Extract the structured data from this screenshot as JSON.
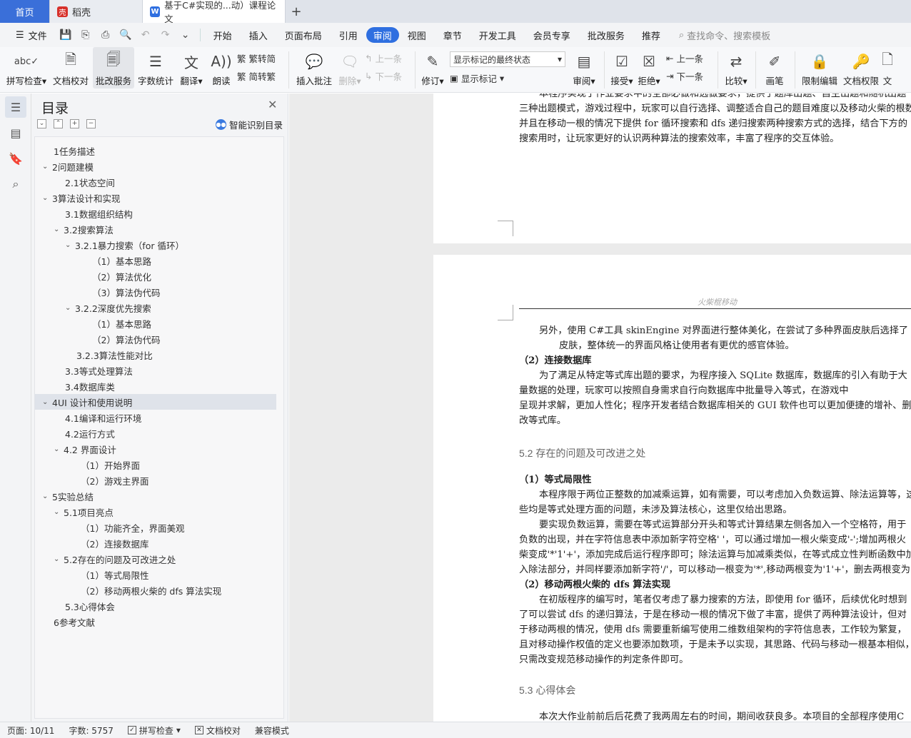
{
  "tabs": [
    {
      "label": "首页"
    },
    {
      "label": "稻壳",
      "icon": "daoke-icon"
    },
    {
      "label": "基于C#实现的...动）课程论文",
      "icon": "wps-writer-icon"
    }
  ],
  "menu": {
    "file": "文件",
    "items": [
      "开始",
      "插入",
      "页面布局",
      "引用",
      "审阅",
      "视图",
      "章节",
      "开发工具",
      "会员专享",
      "批改服务",
      "推荐"
    ],
    "active": "审阅",
    "search_placeholder": "查找命令、搜索模板"
  },
  "ribbon": {
    "spell_check": "拼写检查",
    "doc_proofread": "文档校对",
    "correction_service": "批改服务",
    "word_count": "字数统计",
    "translate": "翻译",
    "read_aloud": "朗读",
    "trad_to_simp": "繁转简",
    "simp_to_trad": "简转繁",
    "insert_comment": "插入批注",
    "delete": "删除",
    "prev": "上一条",
    "next": "下一条",
    "track": "修订",
    "display_mode": "显示标记的最终状态",
    "show_markup": "显示标记",
    "review": "审阅",
    "accept": "接受",
    "reject": "拒绝",
    "prev2": "上一条",
    "next2": "下一条",
    "compare": "比较",
    "pen": "画笔",
    "restrict_edit": "限制编辑",
    "doc_permission": "文档权限",
    "doc_cut": "文"
  },
  "toc": {
    "title": "目录",
    "smart": "智能识别目录",
    "items": [
      {
        "label": "1任务描述"
      },
      {
        "label": "2问题建模"
      },
      {
        "label": "2.1状态空间"
      },
      {
        "label": "3算法设计和实现"
      },
      {
        "label": "3.1数据组织结构"
      },
      {
        "label": "3.2搜索算法"
      },
      {
        "label": "3.2.1暴力搜索（for 循环）"
      },
      {
        "label": "（1）基本思路"
      },
      {
        "label": "（2）算法优化"
      },
      {
        "label": "（3）算法伪代码"
      },
      {
        "label": "3.2.2深度优先搜索"
      },
      {
        "label": "（1）基本思路"
      },
      {
        "label": "（2）算法伪代码"
      },
      {
        "label": "3.2.3算法性能对比"
      },
      {
        "label": "3.3等式处理算法"
      },
      {
        "label": "3.4数据库类"
      },
      {
        "label": "4UI 设计和使用说明"
      },
      {
        "label": "4.1编译和运行环境"
      },
      {
        "label": "4.2运行方式"
      },
      {
        "label": "4.2 界面设计"
      },
      {
        "label": "（1）开始界面"
      },
      {
        "label": "（2）游戏主界面"
      },
      {
        "label": "5实验总结"
      },
      {
        "label": "5.1项目亮点"
      },
      {
        "label": "（1）功能齐全，界面美观"
      },
      {
        "label": "（2）连接数据库"
      },
      {
        "label": "5.2存在的问题及可改进之处"
      },
      {
        "label": "（1）等式局限性"
      },
      {
        "label": "（2）移动两根火柴的 dfs 算法实现"
      },
      {
        "label": "5.3心得体会"
      },
      {
        "label": "6参考文献"
      }
    ]
  },
  "doc": {
    "p1": [
      "本程序实现了作业要求中的全部必做和选做要求，提供了题库出题、自主出题和随机出题",
      "三种出题模式，游戏过程中，玩家可以自行选择、调整适合自己的题目难度以及移动火柴的根数",
      "并且在移动一根的情况下提供 for 循环搜索和 dfs 递归搜索两种搜索方式的选择，结合下方的",
      "搜索用时，让玩家更好的认识两种算法的搜索效率，丰富了程序的交互体验。"
    ],
    "header_note": "火柴棍移动",
    "p2": [
      "另外，使用 C#工具 skinEngine 对界面进行整体美化，在尝试了多种界面皮肤后选择了",
      "皮肤，整体统一的界面风格让使用者有更优的感官体验。"
    ],
    "h_db": "（2）连接数据库",
    "p3": [
      "为了满足从特定等式库出题的要求，为程序接入 SQLite 数据库，数据库的引入有助于大",
      "量数据的处理，玩家可以按照自身需求自行向数据库中批量导入等式，在游戏中",
      "呈现并求解，更加人性化；程序开发者结合数据库相关的 GUI 软件也可以更加便捷的增补、删",
      "改等式库。"
    ],
    "h52": "5.2 存在的问题及可改进之处",
    "h_eq": "（1）等式局限性",
    "p4": [
      "本程序限于两位正整数的加减乘运算，如有需要，可以考虑加入负数运算、除法运算等，这",
      "些均是等式处理方面的问题，未涉及算法核心，这里仅给出思路。",
      "要实现负数运算，需要在等式运算部分开头和等式计算结果左侧各加入一个空格符，用于",
      "负数的出现，并在字符信息表中添加新字符空格' '，可以通过增加一根火柴变成'-';增加两根火",
      "柴变成'*'1'+'，添加完成后运行程序即可；除法运算与加减乘类似，在等式成立性判断函数中加",
      "入除法部分，并同样要添加新字符'/'，可以移动一根变为'*',移动两根变为'1'+'，删去两根变为'/'"
    ],
    "h_dfs": "（2）移动两根火柴的 dfs 算法实现",
    "p5": [
      "在初版程序的编写时，笔者仅考虑了暴力搜索的方法，即使用 for 循环，后续优化时想到",
      "了可以尝试 dfs 的递归算法，于是在移动一根的情况下做了丰富，提供了两种算法设计，但对",
      "于移动两根的情况，使用 dfs 需要重新编写使用二维数组架构的字符信息表，工作较为繁复，",
      "且对移动操作权值的定义也要添加数项，于是未予以实现，其思路、代码与移动一根基本相似，",
      "只需改变规范移动操作的判定条件即可。"
    ],
    "h53": "5.3 心得体会",
    "p6": "本次大作业前前后后花费了我两周左右的时间，期间收获良多。本项目的全部程序使用C"
  },
  "status": {
    "page": "页面: 10/11",
    "words": "字数: 5757",
    "spell": "拼写检查",
    "proof": "文档校对",
    "compat": "兼容模式"
  }
}
